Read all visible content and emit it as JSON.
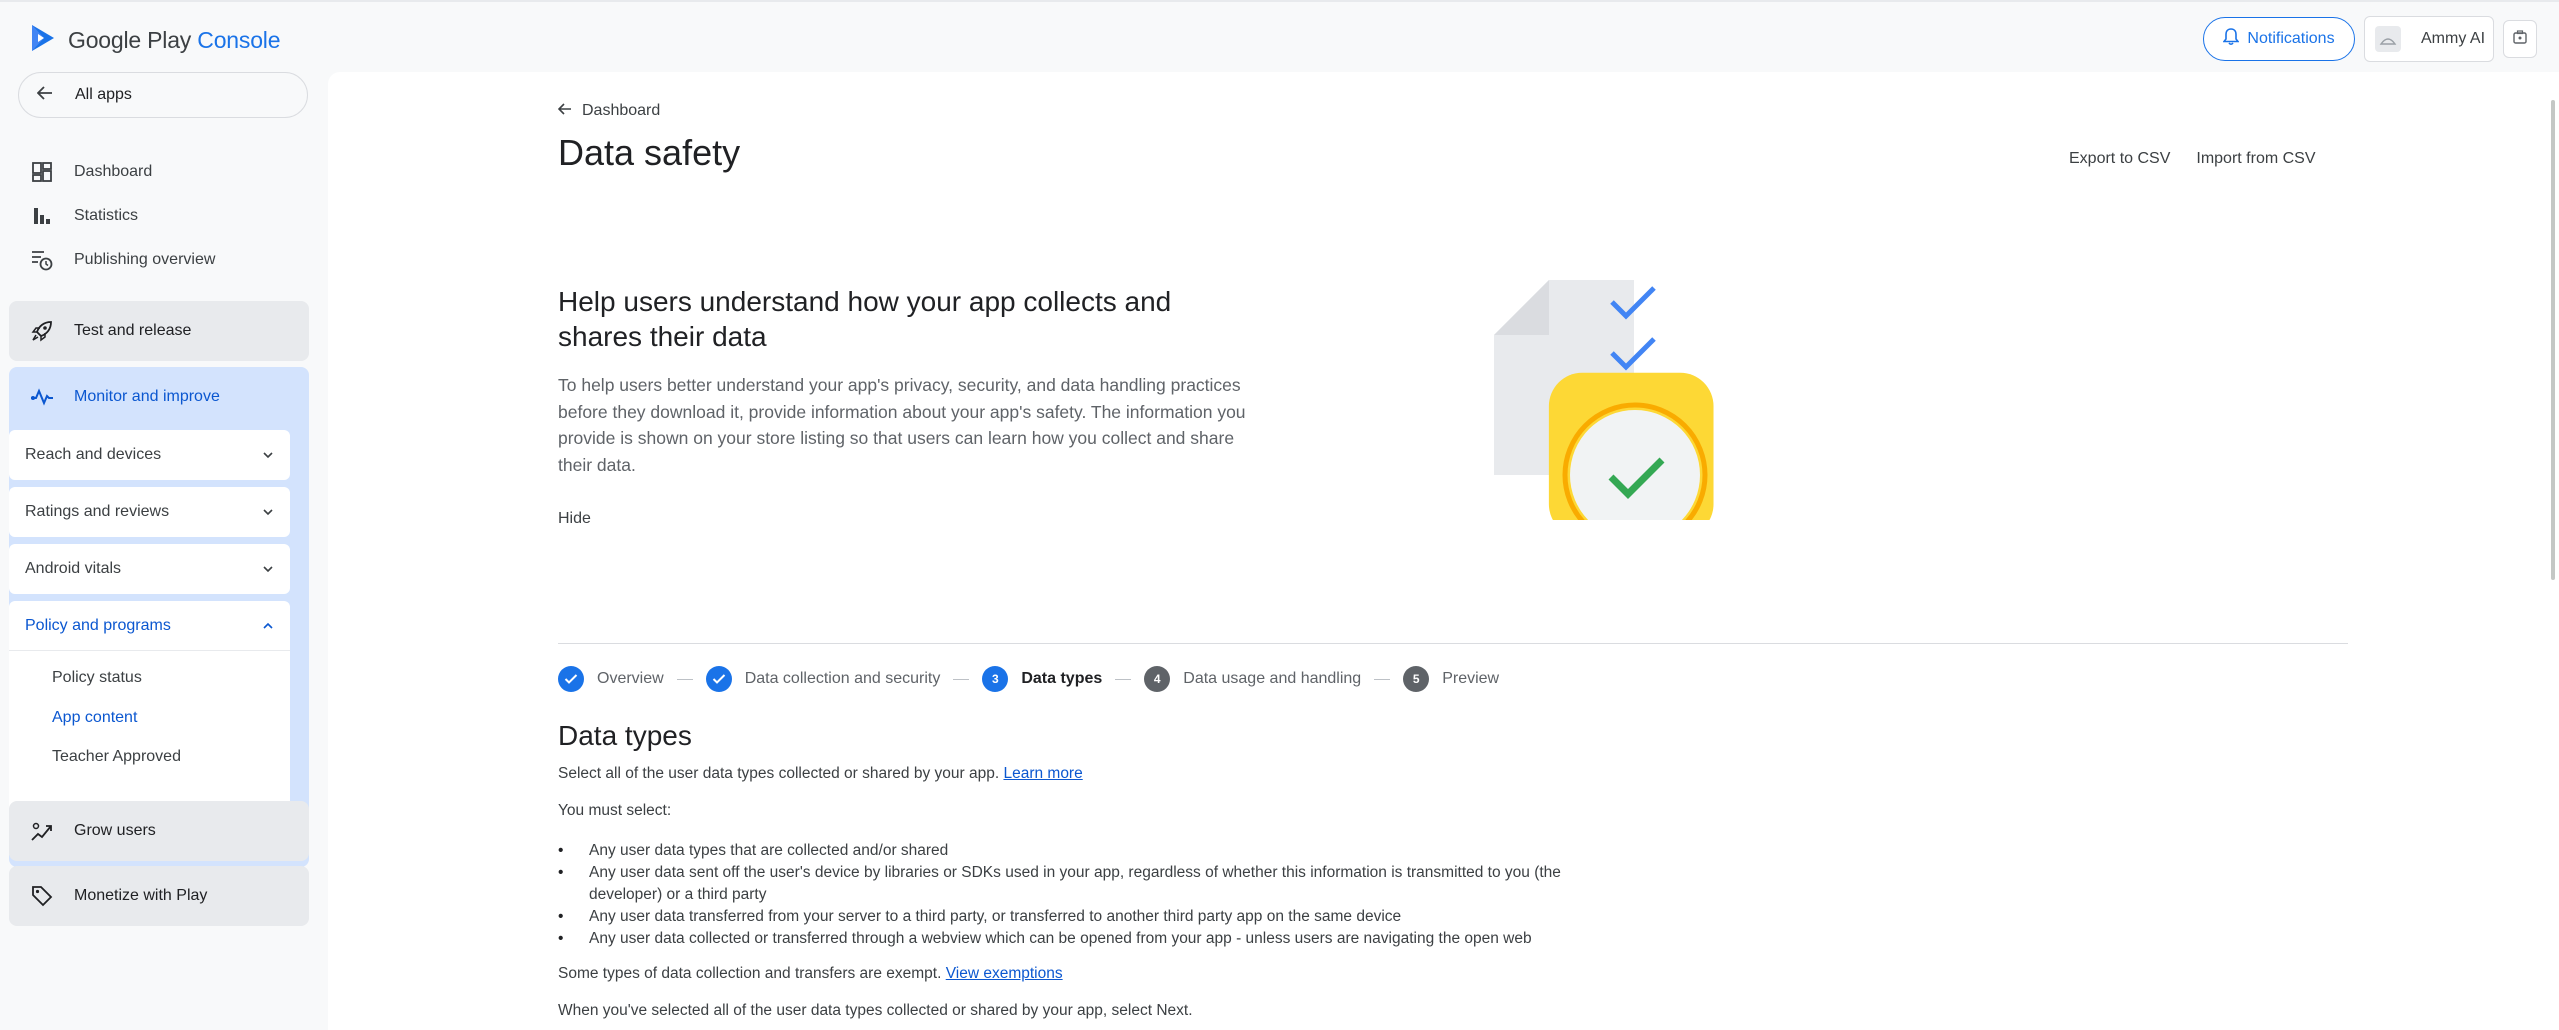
{
  "app": {
    "brand_prefix": "Google Play ",
    "brand_suffix": "Console"
  },
  "header": {
    "notifications_label": "Notifications",
    "account_name": "Ammy AI"
  },
  "sidebar": {
    "all_apps_label": "All apps",
    "nav": [
      {
        "label": "Dashboard",
        "icon": "dashboard-icon"
      },
      {
        "label": "Statistics",
        "icon": "bar-chart-icon"
      },
      {
        "label": "Publishing overview",
        "icon": "publishing-schedule-icon"
      }
    ],
    "test_release": "Test and release",
    "monitor_improve": "Monitor and improve",
    "sub_sections": [
      {
        "label": "Reach and devices"
      },
      {
        "label": "Ratings and reviews"
      },
      {
        "label": "Android vitals"
      },
      {
        "label": "Policy and programs"
      }
    ],
    "policy_items": [
      {
        "label": "Policy status"
      },
      {
        "label": "App content"
      },
      {
        "label": "Teacher Approved"
      }
    ],
    "grow_users": "Grow users",
    "monetize": "Monetize with Play"
  },
  "main": {
    "back_label": "Dashboard",
    "page_title": "Data safety",
    "export_csv": "Export to CSV",
    "import_csv": "Import from CSV",
    "help_title": "Help users understand how your app collects and shares their data",
    "help_body": "To help users better understand your app's privacy, security, and data handling practices before they download it, provide information about your app's safety. The information you provide is shown on your store listing so that users can learn how you collect and share their data.",
    "hide_label": "Hide",
    "steps": [
      {
        "label": "Overview",
        "marker": "✓"
      },
      {
        "label": "Data collection and security",
        "marker": "✓"
      },
      {
        "label": "Data types",
        "marker": "3"
      },
      {
        "label": "Data usage and handling",
        "marker": "4"
      },
      {
        "label": "Preview",
        "marker": "5"
      }
    ],
    "section_title": "Data types",
    "intro": "Select all of the user data types collected or shared by your app. ",
    "learn_more": "Learn more",
    "must_select": "You must select:",
    "bullets": [
      "Any user data types that are collected and/or shared",
      "Any user data sent off the user's device by libraries or SDKs used in your app, regardless of whether this information is transmitted to you (the developer) or a third party",
      "Any user data transferred from your server to a third party, or transferred to another third party app on the same device",
      "Any user data collected or transferred through a webview which can be opened from your app - unless users are navigating the open web"
    ],
    "exempt_text": "Some types of data collection and transfers are exempt. ",
    "view_exemptions": "View exemptions",
    "next_text": "When you've selected all of the user data types collected or shared by your app, select Next."
  },
  "colors": {
    "accent": "#1a73e8",
    "nav_highlight": "#d3e3fd",
    "illustration_yellow": "#fdd835",
    "check_green": "#34a853"
  }
}
